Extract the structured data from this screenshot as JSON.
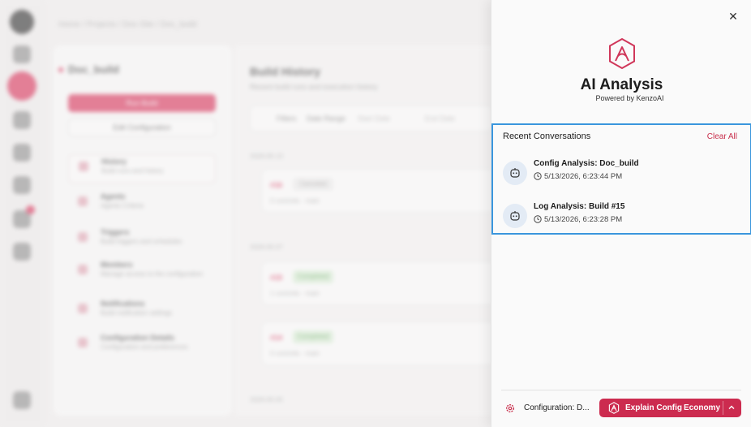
{
  "background": {
    "breadcrumb": "Home / Projects / Doc-Site / Doc_build",
    "config_name": "Doc_build",
    "run_build_label": "Run Build",
    "edit_config_label": "Edit Configuration",
    "nav_items": [
      {
        "title": "History",
        "subtitle": "Build runs and history"
      },
      {
        "title": "Agents",
        "subtitle": "Agents Criteria"
      },
      {
        "title": "Triggers",
        "subtitle": "Build triggers and schedules"
      },
      {
        "title": "Members",
        "subtitle": "Manage access to the configuration"
      },
      {
        "title": "Notifications",
        "subtitle": "Build notification settings"
      },
      {
        "title": "Configuration Details",
        "subtitle": "Configuration and preferences"
      }
    ],
    "main_title": "Build History",
    "main_subtitle": "Recent build runs and execution history",
    "filters_label": "Filters",
    "date_range_label": "Date Range",
    "start_date_placeholder": "Start Date",
    "end_date_placeholder": "End Date",
    "groups": [
      {
        "date": "2026-05-13",
        "runs": [
          {
            "num": "#16",
            "status": "Canceled",
            "status_kind": "grey",
            "meta": "0 commits · main"
          }
        ]
      },
      {
        "date": "2026-05-07",
        "runs": [
          {
            "num": "#15",
            "status": "Completed",
            "status_kind": "green",
            "meta": "1 commits · main"
          },
          {
            "num": "#14",
            "status": "Completed",
            "status_kind": "green",
            "meta": "0 commits · main"
          }
        ]
      },
      {
        "date": "2026-05-05",
        "runs": []
      }
    ]
  },
  "panel": {
    "title": "AI Analysis",
    "powered_by": "Powered by KenzoAI",
    "close_icon": "close-icon",
    "recent": {
      "heading": "Recent Conversations",
      "clear_all": "Clear All",
      "items": [
        {
          "title": "Config Analysis: Doc_build",
          "time": "5/13/2026, 6:23:44 PM"
        },
        {
          "title": "Log Analysis: Build #15",
          "time": "5/13/2026, 6:23:28 PM"
        }
      ]
    },
    "footer": {
      "context_label": "Configuration: D...",
      "explain_label": "Explain Config",
      "model_label": "Economy"
    }
  },
  "colors": {
    "accent": "#cc2b4f",
    "highlight_border": "#3a96dd",
    "avatar_bg": "#e3ebf5"
  }
}
